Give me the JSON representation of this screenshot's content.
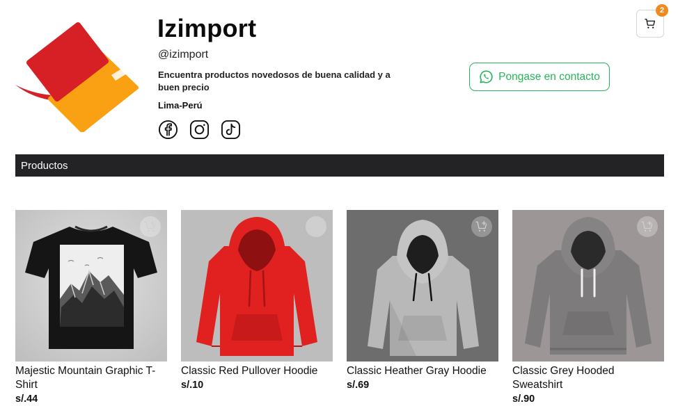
{
  "store": {
    "name": "Izimport",
    "handle": "@izimport",
    "description": "Encuentra productos novedosos de buena calidad y a buen precio",
    "location": "Lima-Perú"
  },
  "socials": [
    {
      "icon": "facebook-icon"
    },
    {
      "icon": "instagram-icon"
    },
    {
      "icon": "tiktok-icon"
    }
  ],
  "contact": {
    "label": "Pongase en contacto",
    "icon": "whatsapp-icon",
    "color": "#25b558"
  },
  "cart": {
    "count": "2",
    "icon": "cart-icon",
    "badge_color": "#f08a1c"
  },
  "section": {
    "title": "Productos"
  },
  "products": [
    {
      "name": "Majestic Mountain Graphic T-Shirt",
      "price": "s/.44"
    },
    {
      "name": "Classic Red Pullover Hoodie",
      "price": "s/.10"
    },
    {
      "name": "Classic Heather Gray Hoodie",
      "price": "s/.69"
    },
    {
      "name": "Classic Grey Hooded Sweatshirt",
      "price": "s/.90"
    }
  ],
  "colors": {
    "logo_red": "#d71f26",
    "logo_orange": "#f9a013",
    "bar": "#232325"
  }
}
